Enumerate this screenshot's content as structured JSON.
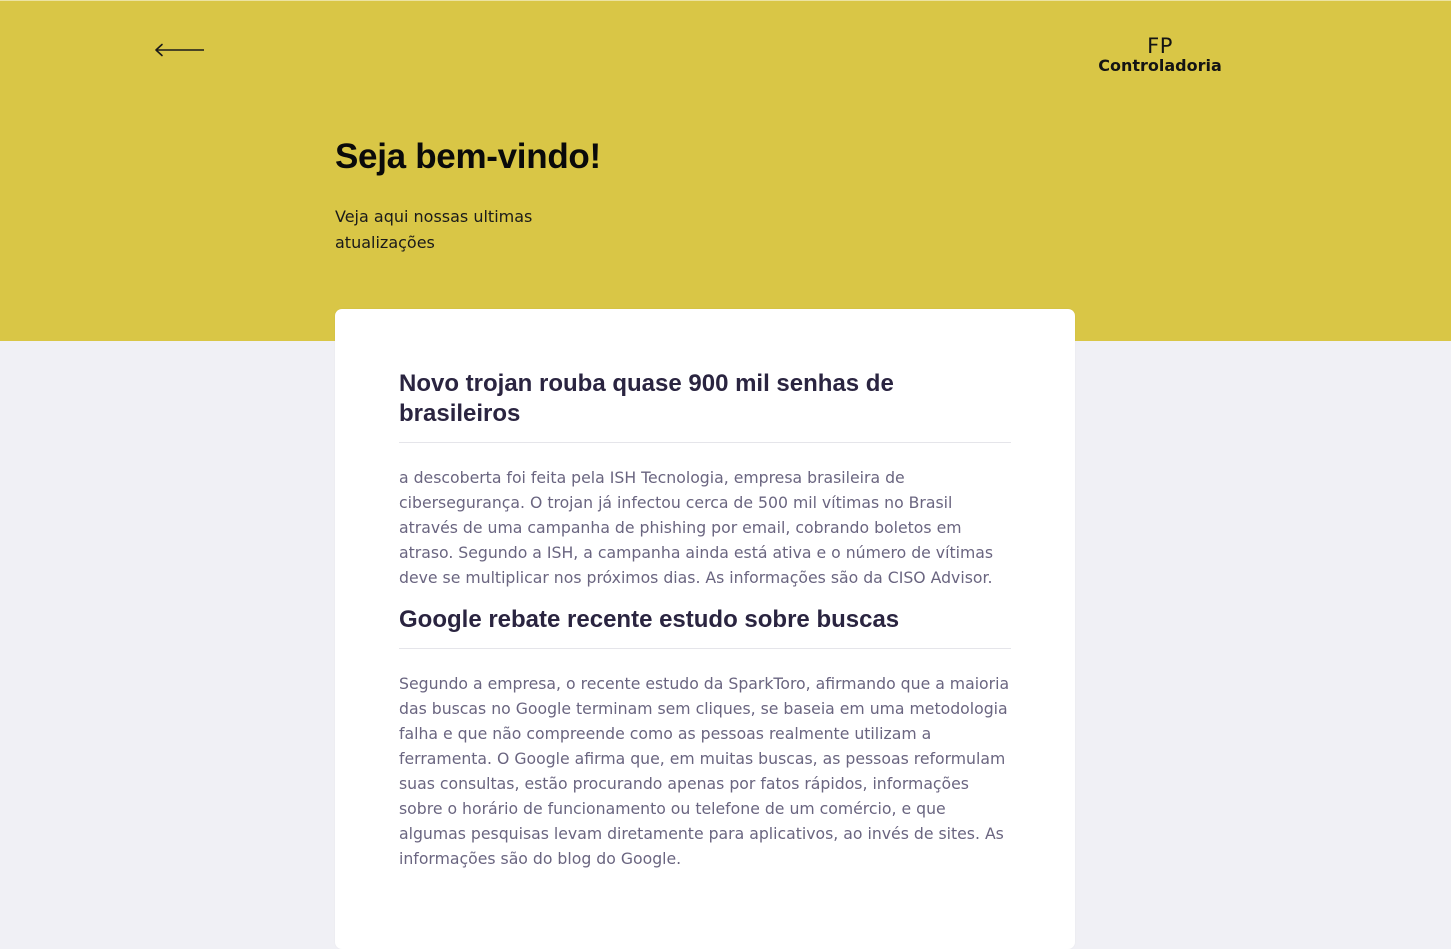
{
  "header": {
    "back_icon": "arrow-left-icon",
    "logo": {
      "initials": "FP",
      "name": "Controladoria"
    },
    "title": "Seja bem-vindo!",
    "subtitle": "Veja aqui nossas ultimas atualizações"
  },
  "news": [
    {
      "title": "Novo trojan rouba quase 900 mil senhas de brasileiros",
      "body": "a descoberta foi feita pela ISH Tecnologia, empresa brasileira de cibersegurança. O trojan já infectou cerca de 500 mil vítimas no Brasil através de uma campanha de phishing por email, cobrando boletos em atraso. Segundo a ISH, a campanha ainda está ativa e o número de vítimas deve se multiplicar nos próximos dias. As informações são da CISO Advisor."
    },
    {
      "title": "Google rebate recente estudo sobre buscas",
      "body": "Segundo a empresa, o recente estudo da SparkToro, afirmando que a maioria das buscas no Google terminam sem cliques, se baseia em uma metodologia falha e que não compreende como as pessoas realmente utilizam a ferramenta. O Google afirma que, em muitas buscas, as pessoas reformulam suas consultas, estão procurando apenas por fatos rápidos, informações sobre o horário de funcionamento ou telefone de um comércio, e que algumas pesquisas levam diretamente para aplicativos, ao invés de sites. As informações são do blog do Google."
    }
  ],
  "colors": {
    "header_background": "#d9c646",
    "page_background": "#f0f0f5",
    "card_background": "#ffffff",
    "title_color": "#2a2440",
    "body_color": "#6a6580"
  }
}
